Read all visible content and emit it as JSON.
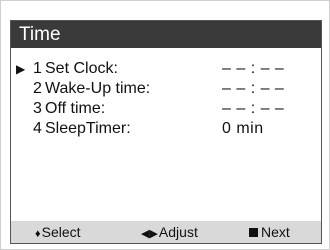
{
  "title": "Time",
  "menu": {
    "items": [
      {
        "number": "1",
        "label": "Set Clock:",
        "value": "– – : – –",
        "selected": true
      },
      {
        "number": "2",
        "label": "Wake-Up time:",
        "value": "– – : – –",
        "selected": false
      },
      {
        "number": "3",
        "label": "Off time:",
        "value": "– – : – –",
        "selected": false
      },
      {
        "number": "4",
        "label": "SleepTimer:",
        "value": "0 min",
        "selected": false
      }
    ],
    "cursor_icon": "right-triangle-icon"
  },
  "footer": {
    "select_label": "Select",
    "adjust_label": "Adjust",
    "next_label": "Next",
    "select_icon": "up-down-arrows-icon",
    "adjust_icon": "left-right-arrows-icon",
    "next_icon": "stop-square-icon"
  }
}
